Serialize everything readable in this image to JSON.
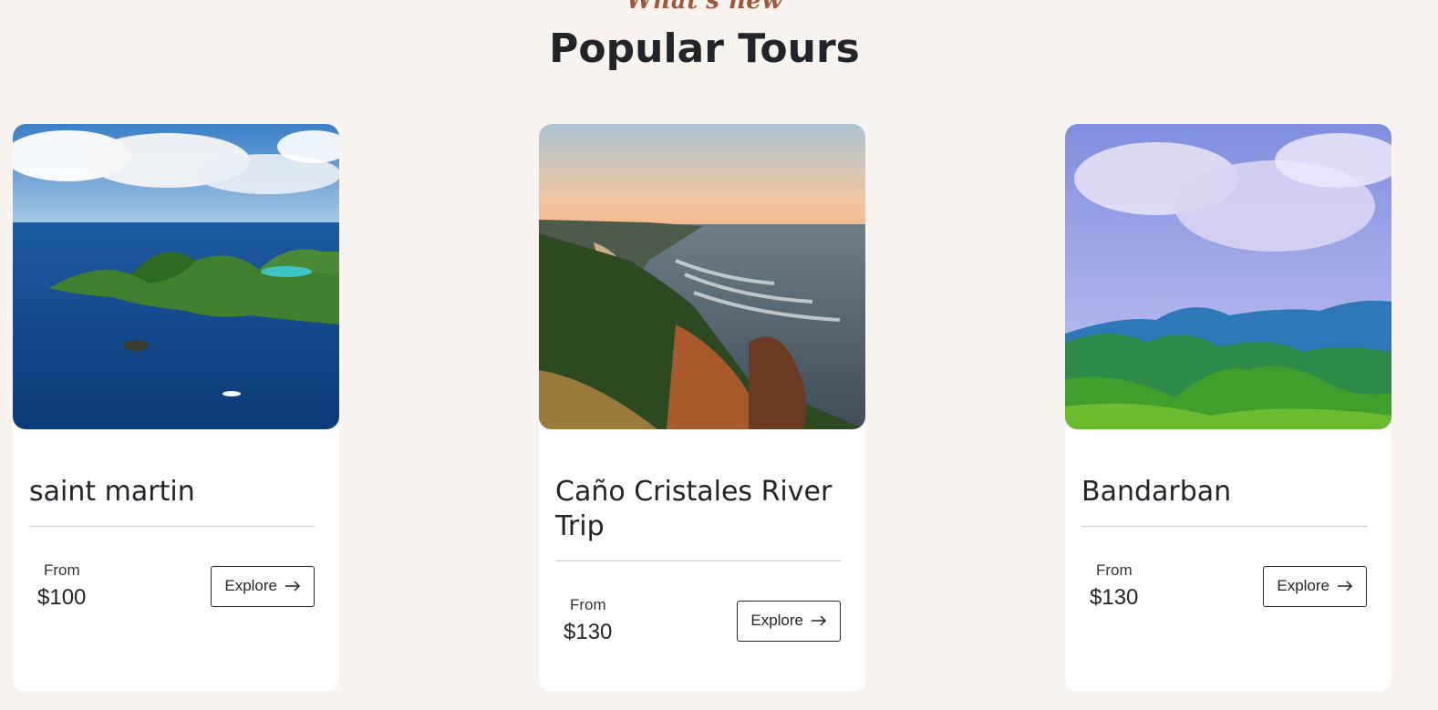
{
  "section": {
    "eyebrow": "What's new",
    "title": "Popular Tours"
  },
  "tours": [
    {
      "name": "saint martin",
      "from_label": "From",
      "price": "$100",
      "button_label": "Explore",
      "image_icon": "island-photo"
    },
    {
      "name": "Caño Cristales River Trip",
      "from_label": "From",
      "price": "$130",
      "button_label": "Explore",
      "image_icon": "coastline-photo"
    },
    {
      "name": "Bandarban",
      "from_label": "From",
      "price": "$130",
      "button_label": "Explore",
      "image_icon": "mountain-photo"
    }
  ],
  "colors": {
    "background": "#f8f3ef",
    "accent": "#a0583a",
    "card": "#ffffff",
    "text": "#212529"
  }
}
